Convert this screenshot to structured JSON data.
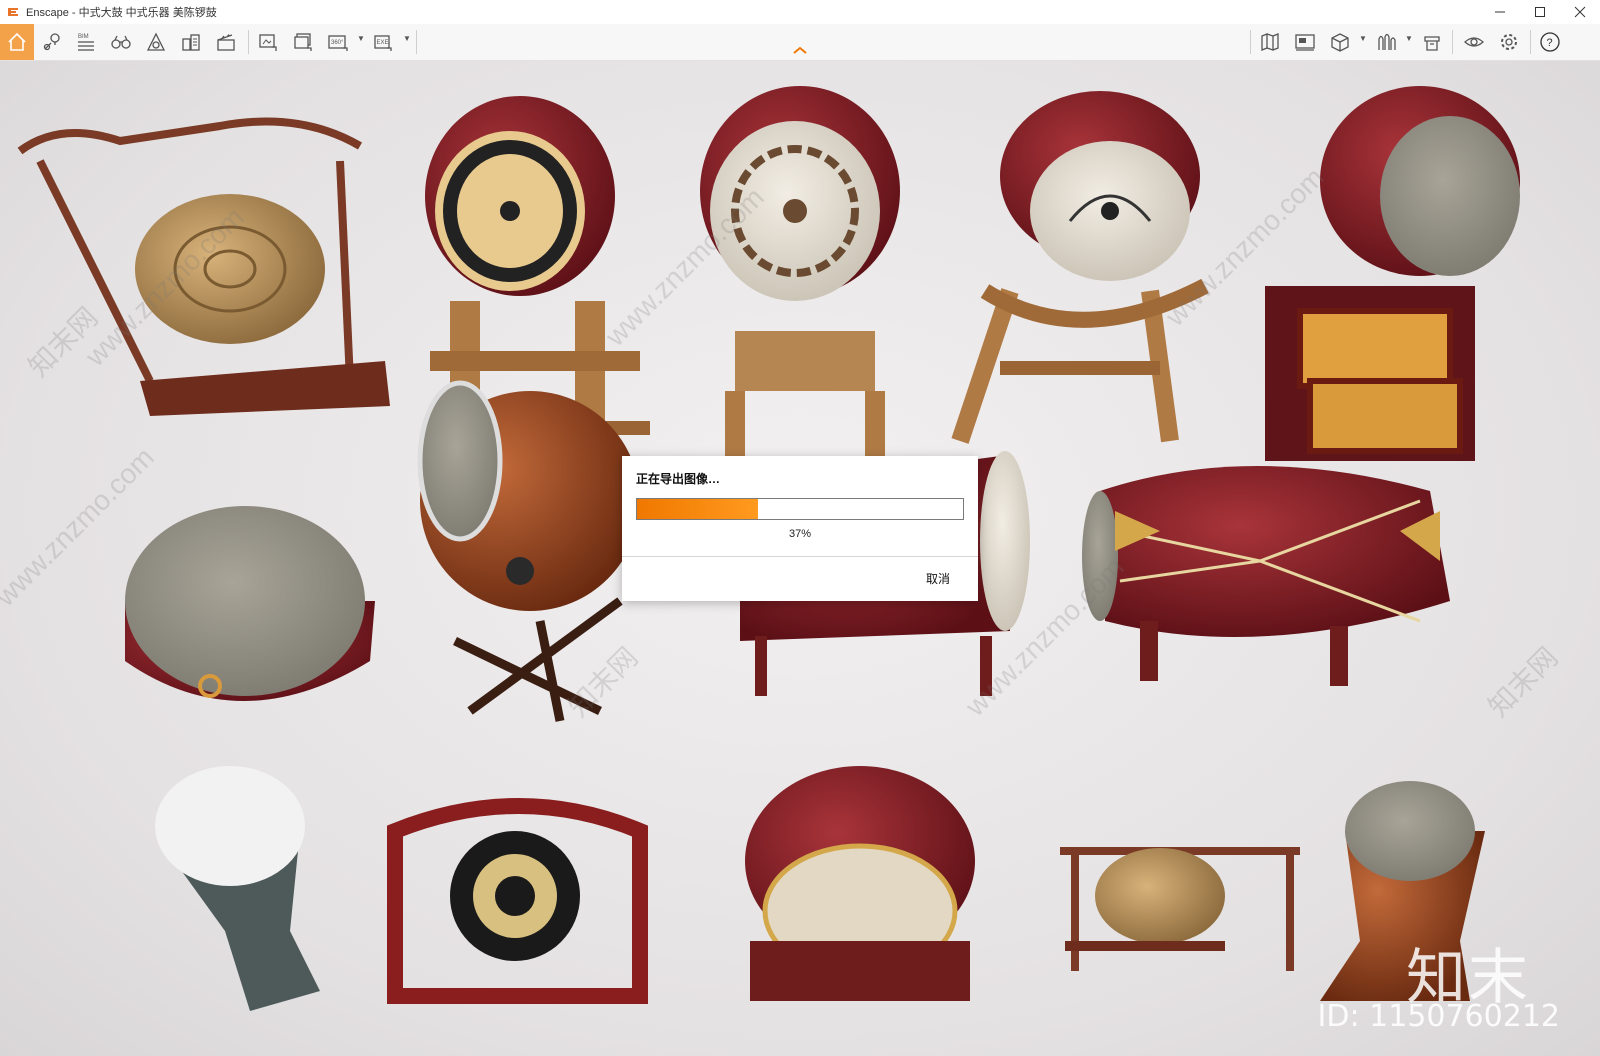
{
  "window": {
    "title": "Enscape - 中式大鼓 中式乐器 美陈锣鼓",
    "controls": [
      "minimize",
      "maximize",
      "close"
    ]
  },
  "toolbar": {
    "left_buttons": [
      "home-icon",
      "location-pin-icon",
      "bim-icon",
      "binoculars-icon",
      "atom-icon",
      "buildings-icon",
      "clapperboard-icon",
      "export-image-icon",
      "batch-render-icon",
      "panorama-360-icon",
      "export-exe-icon"
    ],
    "bim_label": "BIM",
    "pano_label": "360°",
    "exe_label": "EXE",
    "right_buttons": [
      "map-icon",
      "video-editor-icon",
      "cube-view-icon",
      "asset-library-icon",
      "objects-icon",
      "visibility-icon",
      "settings-icon",
      "help-icon"
    ],
    "help_label": "?"
  },
  "dialog": {
    "heading": "正在导出图像…",
    "progress_percent": 37,
    "percent_label": "37%",
    "cancel_label": "取消"
  },
  "watermarks": {
    "site": "www.znzmo.com",
    "cn": "知末网",
    "logo_text": "知末",
    "id_text": "ID: 1150760212"
  },
  "colors": {
    "accent": "#f4a24a",
    "progress": "#f07800",
    "drum_red": "#7d1a20",
    "wood": "#b07a44"
  }
}
